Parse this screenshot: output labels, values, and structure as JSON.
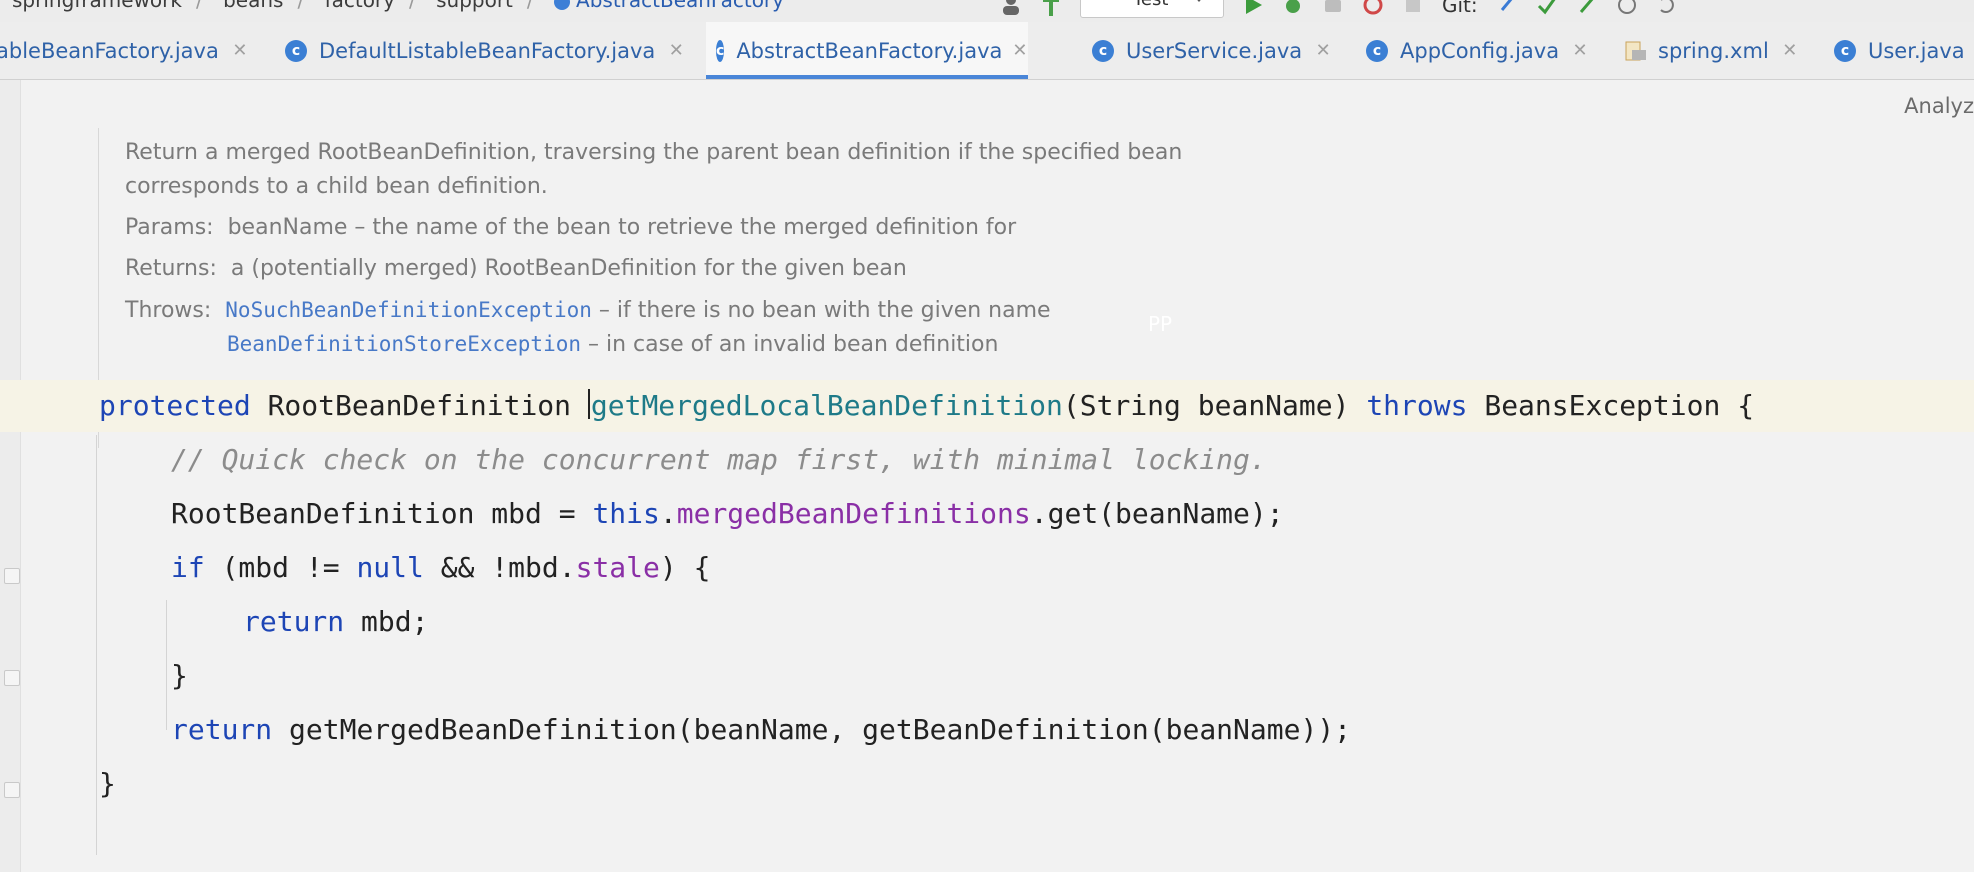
{
  "breadcrumb": {
    "items": [
      "springframework",
      "beans",
      "factory",
      "support",
      "AbstractBeanFactory"
    ]
  },
  "toolbar": {
    "run_config": "Test",
    "git_label": "Git:"
  },
  "tabs": [
    {
      "label": "ableBeanFactory.java",
      "icon": "class-icon",
      "active": false
    },
    {
      "label": "DefaultListableBeanFactory.java",
      "icon": "class-icon",
      "active": false
    },
    {
      "label": "AbstractBeanFactory.java",
      "icon": "class-icon",
      "active": true
    },
    {
      "label": "UserService.java",
      "icon": "class-icon",
      "active": false
    },
    {
      "label": "AppConfig.java",
      "icon": "class-icon",
      "active": false
    },
    {
      "label": "spring.xml",
      "icon": "xml-icon",
      "active": false
    },
    {
      "label": "User.java",
      "icon": "class-icon",
      "active": false
    }
  ],
  "editor": {
    "analyze_label": "Analyz",
    "watermark": "PP",
    "doc": {
      "description_line1": "Return a merged RootBeanDefinition, traversing the parent bean definition if the specified bean",
      "description_line2": "corresponds to a child bean definition.",
      "params_label": "Params:",
      "params_text": "beanName – the name of the bean to retrieve the merged definition for",
      "returns_label": "Returns:",
      "returns_text": "a (potentially merged) RootBeanDefinition for the given bean",
      "throws_label": "Throws:",
      "throws_ex1": "NoSuchBeanDefinitionException",
      "throws_text1": " – if there is no bean with the given name",
      "throws_ex2": "BeanDefinitionStoreException",
      "throws_text2": " – in case of an invalid bean definition"
    },
    "code": {
      "l1_kw": "protected",
      "l1_type": " RootBeanDefinition ",
      "l1_fn": "getMergedLocalBeanDefinition",
      "l1_params": "(String beanName) ",
      "l1_throws": "throws",
      "l1_rest": " BeansException {",
      "l2": "// Quick check on the concurrent map first, with minimal locking.",
      "l3_a": "RootBeanDefinition mbd = ",
      "l3_this": "this",
      "l3_dot": ".",
      "l3_field": "mergedBeanDefinitions",
      "l3_rest": ".get(beanName);",
      "l4_if": "if",
      "l4_a": " (mbd != ",
      "l4_null": "null",
      "l4_b": " && !mbd.",
      "l4_field": "stale",
      "l4_c": ") {",
      "l5_return": "return",
      "l5_rest": " mbd;",
      "l6": "}",
      "l7_return": "return",
      "l7_rest": " getMergedBeanDefinition(beanName, getBeanDefinition(beanName));",
      "l8": "}"
    }
  }
}
